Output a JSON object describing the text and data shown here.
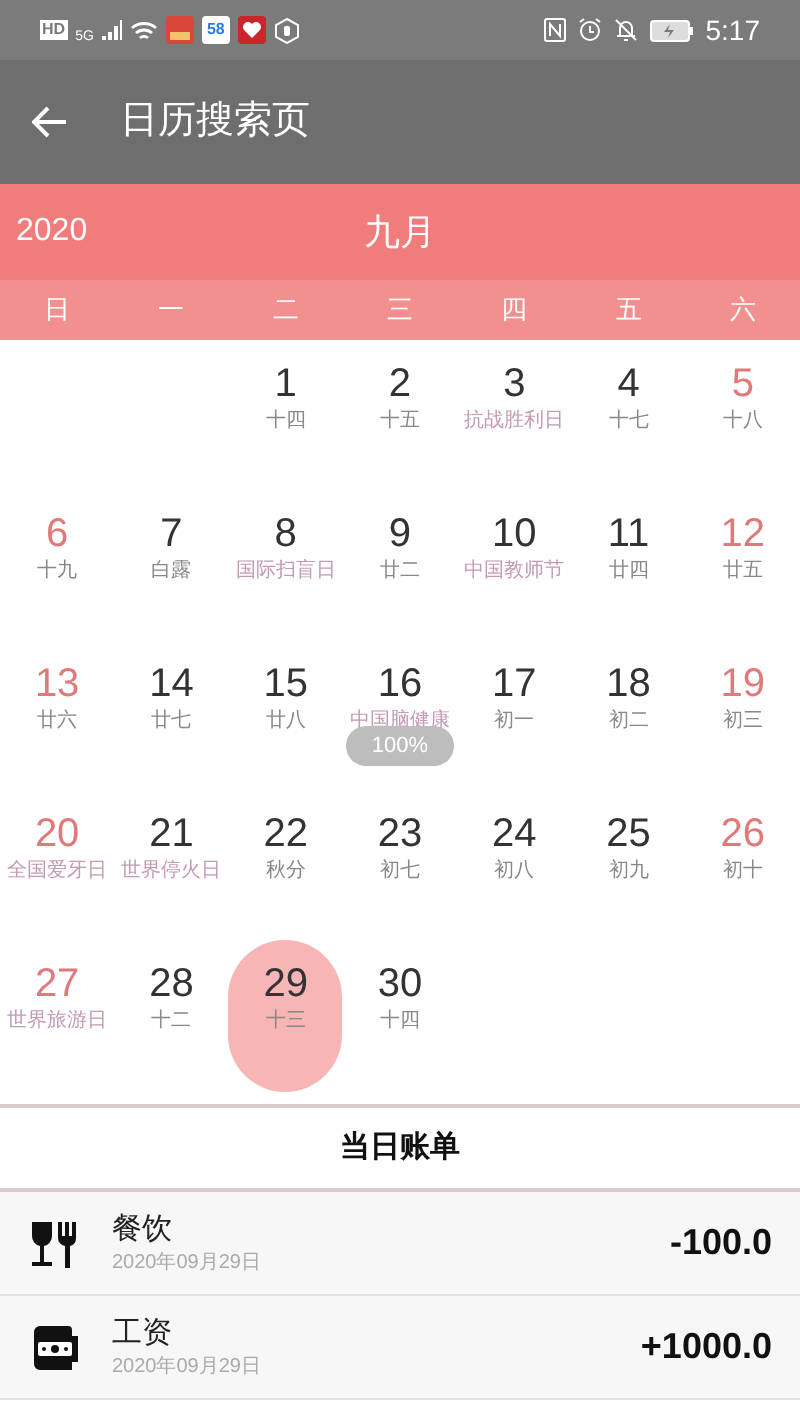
{
  "status_bar": {
    "hd": "HD",
    "network": "5G",
    "app_badge": "58",
    "time": "5:17"
  },
  "header": {
    "title": "日历搜索页"
  },
  "month_bar": {
    "year": "2020",
    "month": "九月"
  },
  "weekdays": [
    "日",
    "一",
    "二",
    "三",
    "四",
    "五",
    "六"
  ],
  "days": [
    {
      "day": "1",
      "sub": "十四",
      "festival": false,
      "selected": false
    },
    {
      "day": "2",
      "sub": "十五",
      "festival": false,
      "selected": false
    },
    {
      "day": "3",
      "sub": "抗战胜利日",
      "festival": true,
      "selected": false
    },
    {
      "day": "4",
      "sub": "十七",
      "festival": false,
      "selected": false
    },
    {
      "day": "5",
      "sub": "十八",
      "festival": false,
      "selected": false
    },
    {
      "day": "6",
      "sub": "十九",
      "festival": false,
      "selected": false
    },
    {
      "day": "7",
      "sub": "白露",
      "festival": false,
      "selected": false
    },
    {
      "day": "8",
      "sub": "国际扫盲日",
      "festival": true,
      "selected": false
    },
    {
      "day": "9",
      "sub": "廿二",
      "festival": false,
      "selected": false
    },
    {
      "day": "10",
      "sub": "中国教师节",
      "festival": true,
      "selected": false
    },
    {
      "day": "11",
      "sub": "廿四",
      "festival": false,
      "selected": false
    },
    {
      "day": "12",
      "sub": "廿五",
      "festival": false,
      "selected": false
    },
    {
      "day": "13",
      "sub": "廿六",
      "festival": false,
      "selected": false
    },
    {
      "day": "14",
      "sub": "廿七",
      "festival": false,
      "selected": false
    },
    {
      "day": "15",
      "sub": "廿八",
      "festival": false,
      "selected": false
    },
    {
      "day": "16",
      "sub": "中国脑健康",
      "festival": true,
      "selected": false
    },
    {
      "day": "17",
      "sub": "初一",
      "festival": false,
      "selected": false
    },
    {
      "day": "18",
      "sub": "初二",
      "festival": false,
      "selected": false
    },
    {
      "day": "19",
      "sub": "初三",
      "festival": false,
      "selected": false
    },
    {
      "day": "20",
      "sub": "全国爱牙日",
      "festival": true,
      "selected": false
    },
    {
      "day": "21",
      "sub": "世界停火日",
      "festival": true,
      "selected": false
    },
    {
      "day": "22",
      "sub": "秋分",
      "festival": false,
      "selected": false
    },
    {
      "day": "23",
      "sub": "初七",
      "festival": false,
      "selected": false
    },
    {
      "day": "24",
      "sub": "初八",
      "festival": false,
      "selected": false
    },
    {
      "day": "25",
      "sub": "初九",
      "festival": false,
      "selected": false
    },
    {
      "day": "26",
      "sub": "初十",
      "festival": false,
      "selected": false
    },
    {
      "day": "27",
      "sub": "世界旅游日",
      "festival": true,
      "selected": false
    },
    {
      "day": "28",
      "sub": "十二",
      "festival": false,
      "selected": false
    },
    {
      "day": "29",
      "sub": "十三",
      "festival": false,
      "selected": true
    },
    {
      "day": "30",
      "sub": "十四",
      "festival": false,
      "selected": false
    }
  ],
  "zoom_toast": "100%",
  "bill": {
    "title": "当日账单",
    "items": [
      {
        "kind": "dining",
        "name": "餐饮",
        "date": "2020年09月29日",
        "amount": "-100.0"
      },
      {
        "kind": "salary",
        "name": "工资",
        "date": "2020年09月29日",
        "amount": "+1000.0"
      }
    ]
  }
}
